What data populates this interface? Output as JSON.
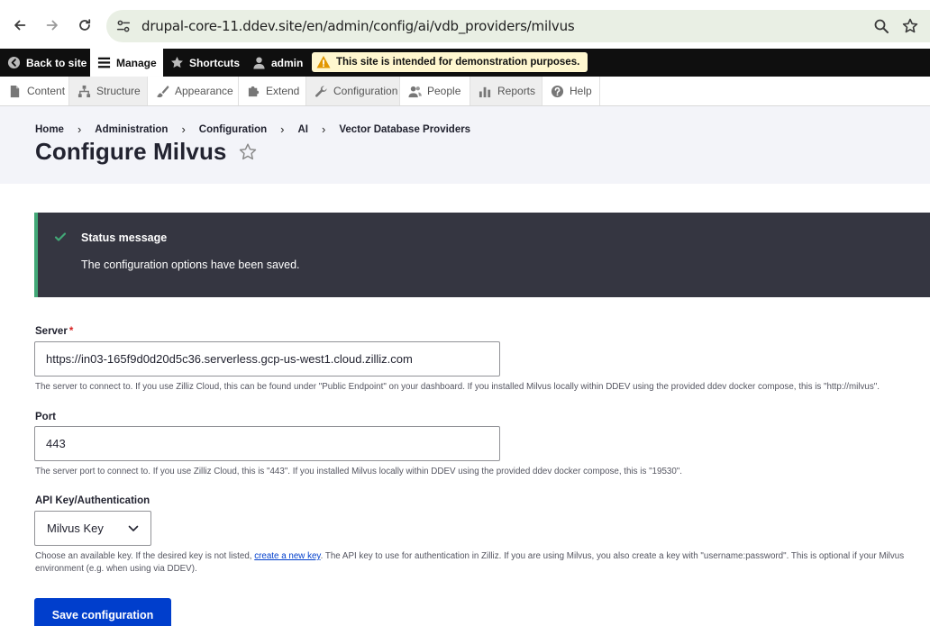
{
  "browser": {
    "url": "drupal-core-11.ddev.site/en/admin/config/ai/vdb_providers/milvus",
    "back_icon": "arrow-left-icon",
    "forward_icon": "arrow-right-icon",
    "reload_icon": "reload-icon",
    "site_info_icon": "tune-icon",
    "zoom_icon": "magnifier-icon",
    "bookmark_icon": "star-outline-icon"
  },
  "toolbar": {
    "back_to_site": "Back to site",
    "manage": "Manage",
    "shortcuts": "Shortcuts",
    "user": "admin",
    "alert": "This site is intended for demonstration purposes."
  },
  "tray": {
    "items": [
      {
        "label": "Content",
        "icon": "document-icon"
      },
      {
        "label": "Structure",
        "icon": "structure-icon"
      },
      {
        "label": "Appearance",
        "icon": "brush-icon"
      },
      {
        "label": "Extend",
        "icon": "puzzle-icon"
      },
      {
        "label": "Configuration",
        "icon": "wrench-icon"
      },
      {
        "label": "People",
        "icon": "people-icon"
      },
      {
        "label": "Reports",
        "icon": "bar-chart-icon"
      },
      {
        "label": "Help",
        "icon": "help-icon"
      }
    ]
  },
  "breadcrumb": [
    "Home",
    "Administration",
    "Configuration",
    "AI",
    "Vector Database Providers"
  ],
  "page": {
    "title": "Configure Milvus"
  },
  "status": {
    "title": "Status message",
    "text": "The configuration options have been saved."
  },
  "form": {
    "server": {
      "label": "Server",
      "required_marker": "*",
      "value": "https://in03-165f9d0d20d5c36.serverless.gcp-us-west1.cloud.zilliz.com",
      "description": "The server to connect to. If you use Zilliz Cloud, this can be found under \"Public Endpoint\" on your dashboard. If you installed Milvus locally within DDEV using the provided ddev docker compose, this is \"http://milvus\"."
    },
    "port": {
      "label": "Port",
      "value": "443",
      "description": "The server port to connect to. If you use Zilliz Cloud, this is \"443\". If you installed Milvus locally within DDEV using the provided ddev docker compose, this is \"19530\"."
    },
    "api_key": {
      "label": "API Key/Authentication",
      "selected": "Milvus Key",
      "description_before": "Choose an available key. If the desired key is not listed, ",
      "description_link": "create a new key",
      "description_after": ". The API key to use for authentication in Zilliz. If you are using Milvus, you also create a key with \"username:password\". This is optional if your Milvus",
      "description_line2": "environment (e.g. when using via DDEV)."
    },
    "save_label": "Save configuration"
  }
}
